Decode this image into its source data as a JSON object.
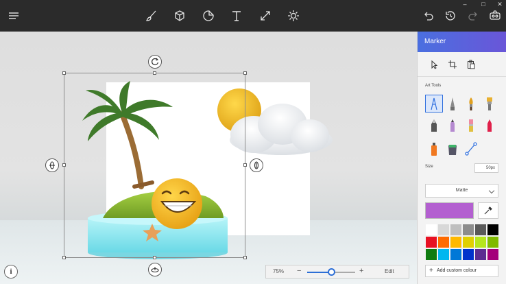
{
  "toolbar": {
    "menu_icon": "hamburger-icon",
    "tools": [
      "brushes-icon",
      "3d-shapes-icon",
      "stickers-icon",
      "text-icon",
      "canvas-icon",
      "effects-icon"
    ],
    "actions": [
      "undo-icon",
      "history-icon",
      "redo-icon",
      "mixed-reality-icon"
    ]
  },
  "window_controls": {
    "minimize": "–",
    "maximize": "□",
    "close": "✕"
  },
  "panel": {
    "title": "Marker",
    "art_tools_label": "Art Tools",
    "size_label": "Size",
    "size_value": "50px",
    "finish": "Matte",
    "current_color": "#b35fd0",
    "add_color_label": "Add custom colour",
    "swatches": [
      "#ffffff",
      "#d8d8d8",
      "#bfbfbf",
      "#8c8c8c",
      "#595959",
      "#000000",
      "#e81123",
      "#ff6a00",
      "#ffb900",
      "#e0d000",
      "#b5e61d",
      "#7fba00",
      "#107c10",
      "#00b7ef",
      "#0078d7",
      "#0033cc",
      "#5c2d91",
      "#a4007a"
    ]
  },
  "zoom": {
    "value_label": "75%",
    "minus": "−",
    "plus": "+",
    "edit_label": "Edit",
    "level": 0.75
  },
  "info_label": "i"
}
